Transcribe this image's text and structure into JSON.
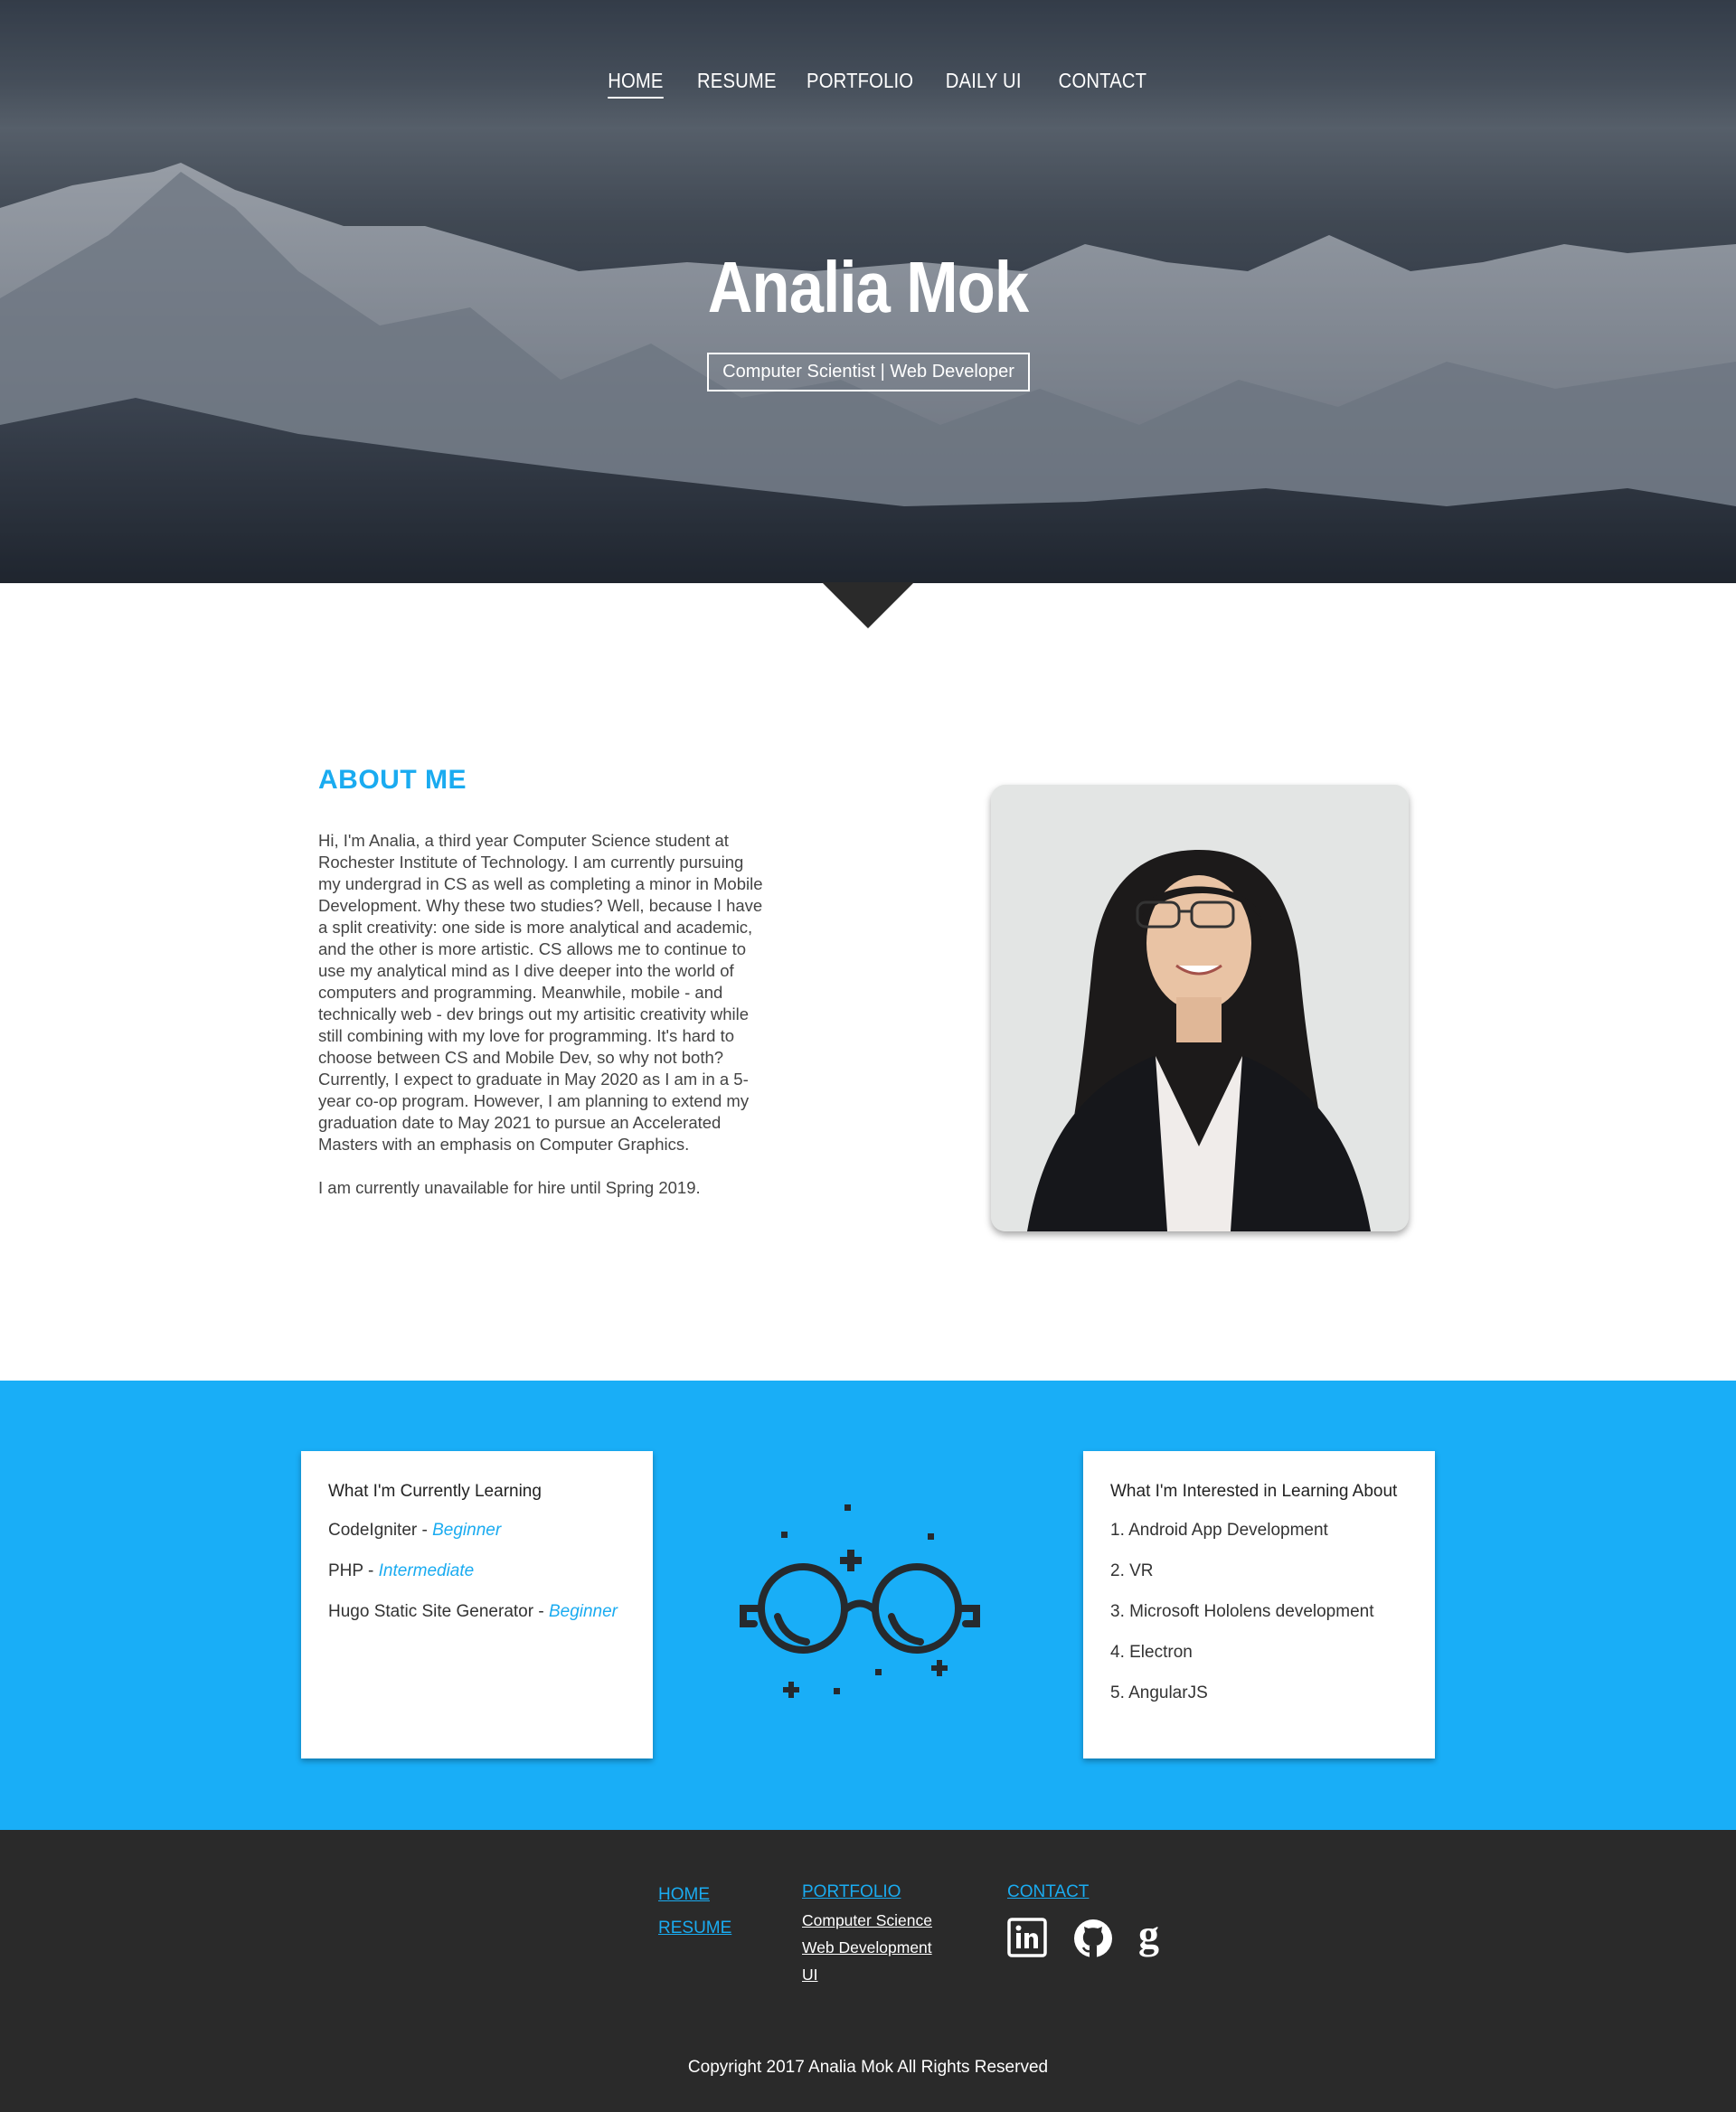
{
  "nav": {
    "items": [
      "HOME",
      "RESUME",
      "PORTFOLIO",
      "DAILY UI",
      "CONTACT"
    ],
    "active": "HOME"
  },
  "hero": {
    "name": "Analia Mok",
    "tagline": "Computer Scientist | Web Developer"
  },
  "about": {
    "title": "ABOUT ME",
    "paragraph1": "Hi, I'm Analia, a third year Computer Science student at Rochester Institute of Technology. I am currently pursuing my undergrad in CS as well as completing a minor in Mobile Development. Why these two studies? Well, because I have a split creativity: one side is more analytical and academic, and the other is more artistic. CS allows me to continue to use my analytical mind as I dive deeper into the world of computers and programming. Meanwhile, mobile - and technically web - dev brings out my artisitic creativity while still combining with my love for programming. It's hard to choose between CS and Mobile Dev, so why not both? Currently, I expect to graduate in May 2020 as I am in a 5-year co-op program. However, I am planning to extend my graduation date to May 2021 to pursue an Accelerated Masters with an emphasis on Computer Graphics.",
    "paragraph2": "I am currently unavailable for hire until Spring 2019."
  },
  "learning": {
    "title": "What I'm Currently Learning",
    "items": [
      {
        "name": "CodeIgniter - ",
        "level": "Beginner"
      },
      {
        "name": "PHP - ",
        "level": "Intermediate"
      },
      {
        "name": "Hugo Static Site Generator - ",
        "level": "Beginner"
      }
    ]
  },
  "interested": {
    "title": "What I'm Interested in Learning About",
    "items": [
      "1. Android App Development",
      "2. VR",
      "3. Microsoft Hololens development",
      "4. Electron",
      "5. AngularJS"
    ]
  },
  "footer": {
    "home": "HOME",
    "resume": "RESUME",
    "portfolio": "PORTFOLIO",
    "portfolio_items": [
      "Computer Science",
      "Web Development",
      "UI"
    ],
    "contact": "CONTACT",
    "social": [
      "linkedin-icon",
      "github-icon",
      "google-icon"
    ],
    "copyright": "Copyright 2017 Analia Mok All Rights Reserved"
  },
  "colors": {
    "accent": "#19aef7",
    "footer_bg": "#2a2a2a"
  }
}
